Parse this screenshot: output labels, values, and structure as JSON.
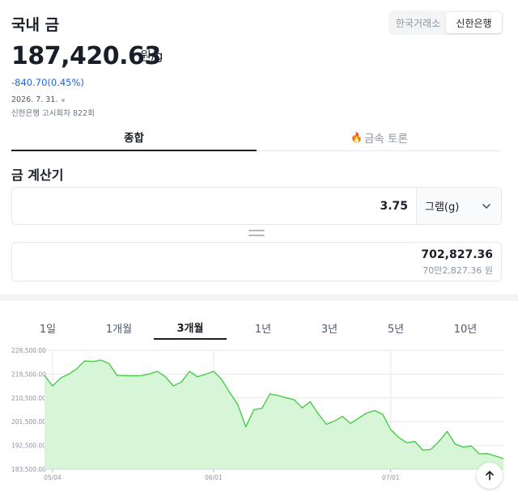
{
  "header": {
    "title": "국내 금",
    "sources": [
      {
        "label": "한국거래소",
        "active": false
      },
      {
        "label": "신한은행",
        "active": true
      }
    ]
  },
  "quote": {
    "price": "187,420.63",
    "unit": "원/g",
    "change": "-840.70(0.45%)",
    "date": "2026. 7. 31.",
    "notice": "신한은행 고시회차 822회"
  },
  "tabs": [
    {
      "label": "종합",
      "active": true
    },
    {
      "label": "금속 토론",
      "active": false,
      "icon": "flame-icon"
    }
  ],
  "calculator": {
    "title": "금 계산기",
    "amount": "3.75",
    "unit_label": "그램(g)",
    "result": "702,827.36",
    "result_korean": "70만2,827.36 원"
  },
  "periods": [
    {
      "label": "1일",
      "active": false
    },
    {
      "label": "1개월",
      "active": false
    },
    {
      "label": "3개월",
      "active": true
    },
    {
      "label": "1년",
      "active": false
    },
    {
      "label": "3년",
      "active": false
    },
    {
      "label": "5년",
      "active": false
    },
    {
      "label": "10년",
      "active": false
    }
  ],
  "colors": {
    "line": "#3ec93e",
    "fill": "#d7f5d7",
    "negative": "#1b64da",
    "grid": "#e5e8eb"
  },
  "chart_data": {
    "type": "area",
    "y_ticks": [
      "183,500.00",
      "192,500.00",
      "201,500.00",
      "210,500.00",
      "219,500.00",
      "228,500.00"
    ],
    "y_tick_values": [
      183500,
      192500,
      201500,
      210500,
      219500,
      228500
    ],
    "ylim": [
      183500,
      228500
    ],
    "x_ticks": [
      "05/04",
      "06/01",
      "07/01"
    ],
    "x_tick_index": [
      1,
      21,
      43
    ],
    "grid": true,
    "values": [
      219000,
      215000,
      218000,
      219500,
      221500,
      224500,
      224200,
      224800,
      223500,
      219000,
      218900,
      218800,
      218900,
      219500,
      220500,
      218500,
      215000,
      216500,
      220500,
      218500,
      219400,
      220500,
      217500,
      212500,
      208000,
      199500,
      206000,
      206500,
      212000,
      211400,
      210500,
      209800,
      206700,
      209000,
      204500,
      200500,
      201700,
      203500,
      200800,
      202800,
      204700,
      205700,
      204300,
      198500,
      195500,
      193500,
      194000,
      190700,
      191000,
      194000,
      197800,
      193000,
      191800,
      192300,
      189300,
      189400,
      188500,
      187500
    ]
  }
}
